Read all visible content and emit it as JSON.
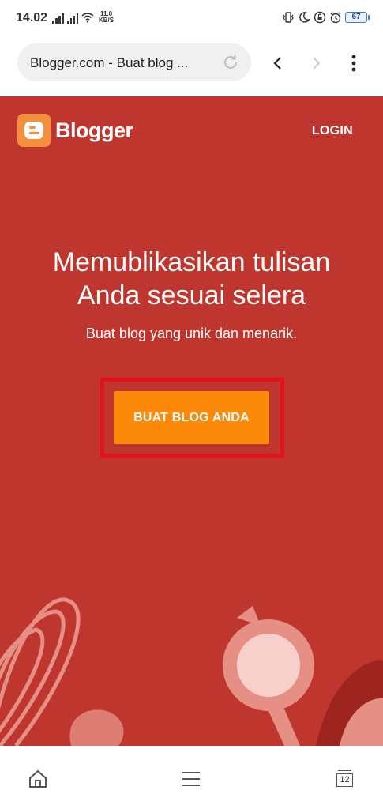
{
  "status_bar": {
    "time": "14.02",
    "net_speed_value": "11.0",
    "net_speed_unit": "KB/S",
    "battery_level": "67",
    "icons": [
      "signal-icon",
      "signal-icon",
      "wifi-icon",
      "vibrate-icon",
      "moon-icon",
      "lock-rotation-icon",
      "alarm-icon",
      "battery-icon"
    ]
  },
  "browser": {
    "url_text": "Blogger.com - Buat blog ...",
    "icons": [
      "reload-icon",
      "back-icon",
      "forward-icon",
      "more-vert-icon"
    ]
  },
  "page": {
    "brand_name": "Blogger",
    "login_label": "LOGIN",
    "hero_title_line1": "Memublikasikan tulisan",
    "hero_title_line2": "Anda sesuai selera",
    "hero_subtitle": "Buat blog yang unik dan menarik.",
    "cta_label": "BUAT BLOG ANDA",
    "colors": {
      "background": "#bf362f",
      "cta": "#fb8a0b",
      "highlight": "#e3121e",
      "logo": "#f4903c"
    }
  },
  "bottom_nav": {
    "tabs_count": "12",
    "icons": [
      "home-icon",
      "menu-icon",
      "tabs-icon"
    ]
  }
}
